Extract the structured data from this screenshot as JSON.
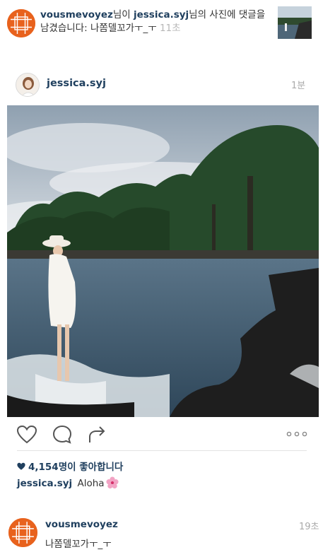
{
  "notification": {
    "actor": "vousmevoyez",
    "actor_suffix": "님이 ",
    "target": "jessica.syj",
    "message": "님의 사진에 댓글을 남겼습니다: 나쫌델꼬가ㅜ_ㅜ",
    "time": "11초"
  },
  "post": {
    "username": "jessica.syj",
    "time": "1분",
    "likes": "4,154명이 좋아합니다",
    "caption_user": "jessica.syj",
    "caption_text": "Aloha"
  },
  "comment": {
    "username": "vousmevoyez",
    "time": "19초",
    "text": "나쫌델꼬가ㅜ_ㅜ"
  },
  "colors": {
    "brand_avatar": "#e8621d",
    "username_blue": "#1f3f5e",
    "muted_gray": "#aaaaaa"
  },
  "icons": {
    "like": "heart-outline-icon",
    "comment": "speech-bubble-icon",
    "share": "share-arrow-icon",
    "more": "more-dots-icon",
    "likes_heart": "heart-filled-icon",
    "emoji": "hibiscus-flower-emoji"
  }
}
